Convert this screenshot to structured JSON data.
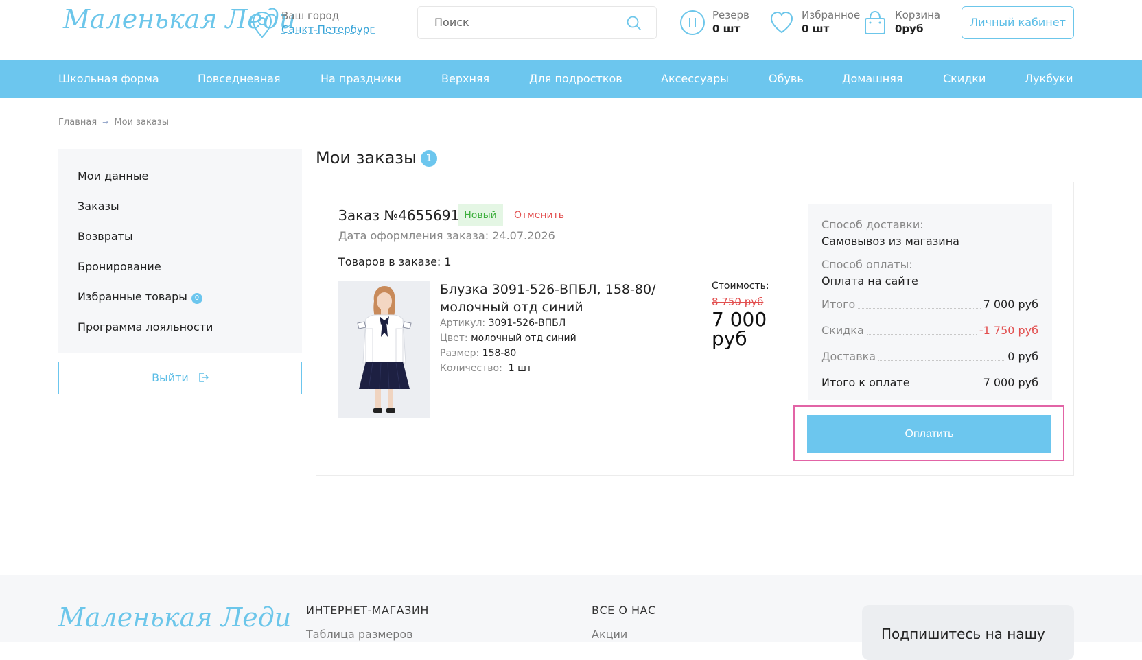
{
  "header": {
    "logo_text": "Маленькая Леди",
    "city_label": "Ваш город",
    "city_value": "Санкт-Петербург",
    "search_placeholder": "Поиск",
    "reserve_label": "Резерв",
    "reserve_value": "0 шт",
    "favorites_label": "Избранное",
    "favorites_value": "0 шт",
    "cart_label": "Корзина",
    "cart_value": "0руб",
    "cabinet_label": "Личный кабинет"
  },
  "nav": {
    "items": [
      "Школьная форма",
      "Повседневная",
      "На праздники",
      "Верхняя",
      "Для подростков",
      "Аксессуары",
      "Обувь",
      "Домашняя",
      "Скидки",
      "Лукбуки"
    ]
  },
  "breadcrumb": {
    "home": "Главная",
    "current": "Мои заказы"
  },
  "sidebar": {
    "items": [
      "Мои данные",
      "Заказы",
      "Возвраты",
      "Бронирование",
      "Избранные товары",
      "Программа лояльности"
    ],
    "favorites_count": "0",
    "logout_label": "Выйти"
  },
  "page": {
    "title": "Мои заказы",
    "orders_count": "1"
  },
  "order": {
    "number": "Заказ №4655691",
    "status": "Новый",
    "cancel_label": "Отменить",
    "date": "Дата оформления заказа: 24.07.2026",
    "items_count": "Товаров в заказе: 1",
    "product": {
      "name": "Блузка 3091-526-ВПБЛ, 158-80/ молочный отд синий",
      "article_label": "Артикул:",
      "article_value": "3091-526-ВПБЛ",
      "color_label": "Цвет:",
      "color_value": "молочный отд синий",
      "size_label": "Размер:",
      "size_value": "158-80",
      "qty_label": "Количество:",
      "qty_value": "1 шт"
    },
    "price_label": "Стоимость:",
    "price_old": "8 750 руб",
    "price_new": "7 000 руб",
    "delivery_method_label": "Способ доставки:",
    "delivery_method_value": "Самовывоз из магазина",
    "payment_method_label": "Способ оплаты:",
    "payment_method_value": "Оплата на сайте",
    "total_label": "Итого",
    "total_value": "7 000 руб",
    "discount_label": "Скидка",
    "discount_value": "-1 750 руб",
    "delivery_label": "Доставка",
    "delivery_value": "0 руб",
    "to_pay_label": "Итого к оплате",
    "to_pay_value": "7 000 руб",
    "pay_button": "Оплатить"
  },
  "footer": {
    "logo_text": "Маленькая Леди",
    "col1_title": "ИНТЕРНЕТ-МАГАЗИН",
    "col1_link": "Таблица размеров",
    "col2_title": "ВСЕ О НАС",
    "col2_link": "Акции",
    "subscribe_title": "Подпишитесь на нашу"
  },
  "colors": {
    "accent": "#6cc6ee",
    "danger": "#e24f4f",
    "success": "#3cae3c",
    "highlight": "#e264a6"
  }
}
